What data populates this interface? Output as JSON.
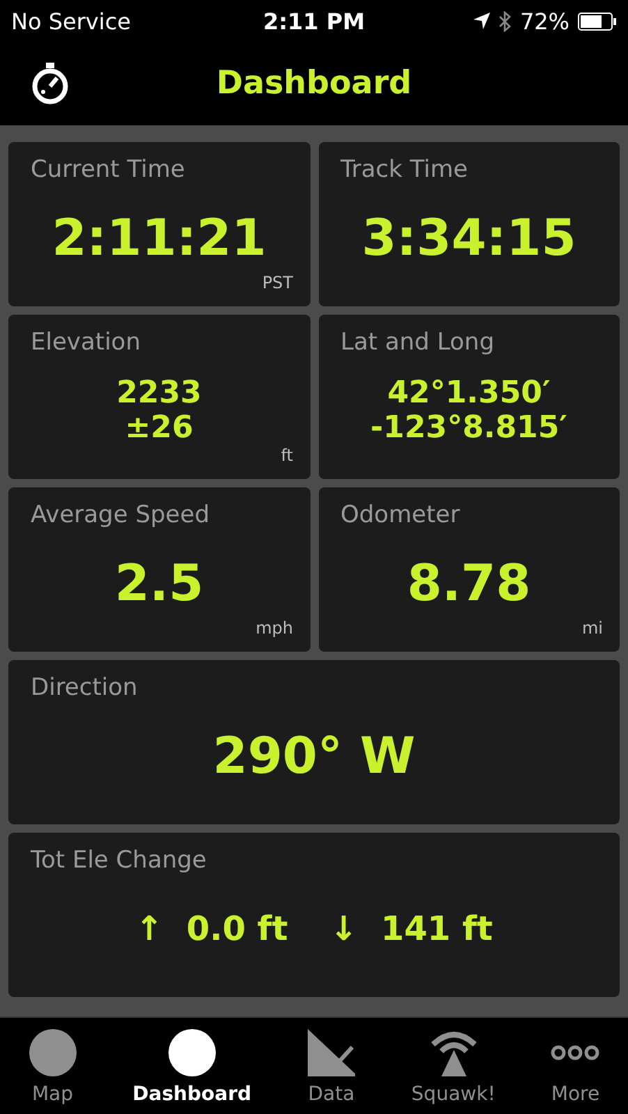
{
  "status_bar": {
    "carrier": "No Service",
    "time": "2:11 PM",
    "battery": "72%"
  },
  "header": {
    "title": "Dashboard"
  },
  "tiles": [
    {
      "title": "Current Time",
      "kind": "half",
      "values": [
        "2:11:21"
      ],
      "unit": "PST"
    },
    {
      "title": "Track Time",
      "kind": "half",
      "values": [
        "3:34:15"
      ]
    },
    {
      "title": "Elevation",
      "kind": "half",
      "values": [
        "2233",
        "±26"
      ],
      "unit": "ft"
    },
    {
      "title": "Lat and Long",
      "kind": "half",
      "values": [
        "42°1.350′",
        "-123°8.815′"
      ]
    },
    {
      "title": "Average Speed",
      "kind": "half",
      "values": [
        "2.5"
      ],
      "unit": "mph"
    },
    {
      "title": "Odometer",
      "kind": "half",
      "values": [
        "8.78"
      ],
      "unit": "mi"
    },
    {
      "title": "Direction",
      "kind": "wide",
      "values": [
        "290° W"
      ]
    },
    {
      "title": "Tot Ele Change",
      "kind": "split",
      "values": [
        "↑  0.0 ft",
        "↓  141 ft"
      ]
    }
  ],
  "tabs": [
    {
      "label": "Map",
      "kind": "circle",
      "selected": false
    },
    {
      "label": "Dashboard",
      "kind": "circle",
      "selected": true
    },
    {
      "label": "Data",
      "kind": "chart",
      "selected": false
    },
    {
      "label": "Squawk!",
      "kind": "antenna",
      "selected": false
    },
    {
      "label": "More",
      "kind": "dots",
      "selected": false
    }
  ]
}
